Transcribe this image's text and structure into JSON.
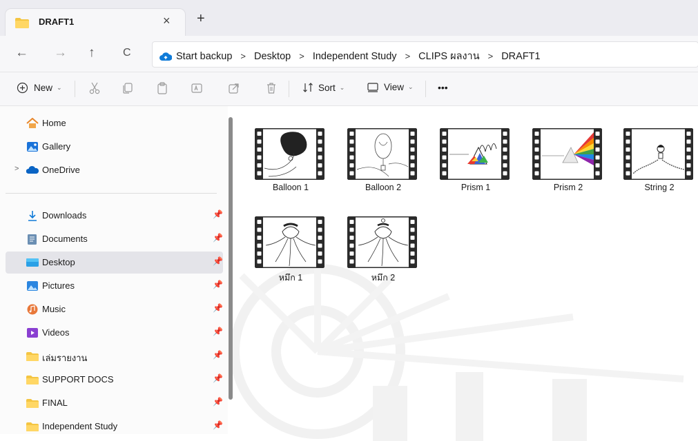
{
  "tab": {
    "title": "DRAFT1",
    "close": "×",
    "new": "+"
  },
  "nav": {
    "back": "←",
    "forward": "→",
    "up": "↑",
    "refresh": "C"
  },
  "address": {
    "backup": "Start backup",
    "sep": ">",
    "crumbs": [
      "Desktop",
      "Independent Study",
      "CLIPS ผลงาน",
      "DRAFT1"
    ]
  },
  "toolbar": {
    "new": "New",
    "sort": "Sort",
    "view": "View",
    "more": "•••",
    "caret": "⌄"
  },
  "sidebar": {
    "expander": ">",
    "pin": "📌",
    "top": [
      {
        "label": "Home",
        "icon": "home-icon"
      },
      {
        "label": "Gallery",
        "icon": "gallery-icon"
      },
      {
        "label": "OneDrive",
        "icon": "onedrive-icon"
      }
    ],
    "quick": [
      {
        "label": "Downloads",
        "icon": "download-icon"
      },
      {
        "label": "Documents",
        "icon": "documents-icon"
      },
      {
        "label": "Desktop",
        "icon": "desktop-icon",
        "selected": true
      },
      {
        "label": "Pictures",
        "icon": "pictures-icon"
      },
      {
        "label": "Music",
        "icon": "music-icon"
      },
      {
        "label": "Videos",
        "icon": "videos-icon"
      },
      {
        "label": "เล่มรายงาน",
        "icon": "folder-icon"
      },
      {
        "label": "SUPPORT DOCS",
        "icon": "folder-icon"
      },
      {
        "label": "FINAL",
        "icon": "folder-icon"
      },
      {
        "label": "Independent Study",
        "icon": "folder-icon"
      }
    ]
  },
  "files": [
    {
      "name": "Balloon 1",
      "art": "balloon1"
    },
    {
      "name": "Balloon 2",
      "art": "balloon2"
    },
    {
      "name": "Prism 1",
      "art": "prism1"
    },
    {
      "name": "Prism 2",
      "art": "prism2"
    },
    {
      "name": "String 2",
      "art": "string2"
    },
    {
      "name": "หมึก 1",
      "art": "squid1"
    },
    {
      "name": "หมึก 2",
      "art": "squid2"
    }
  ],
  "colors": {
    "accent": "#0067c0",
    "folder": "#f4c542",
    "selected_bg": "#e4e4e9"
  }
}
